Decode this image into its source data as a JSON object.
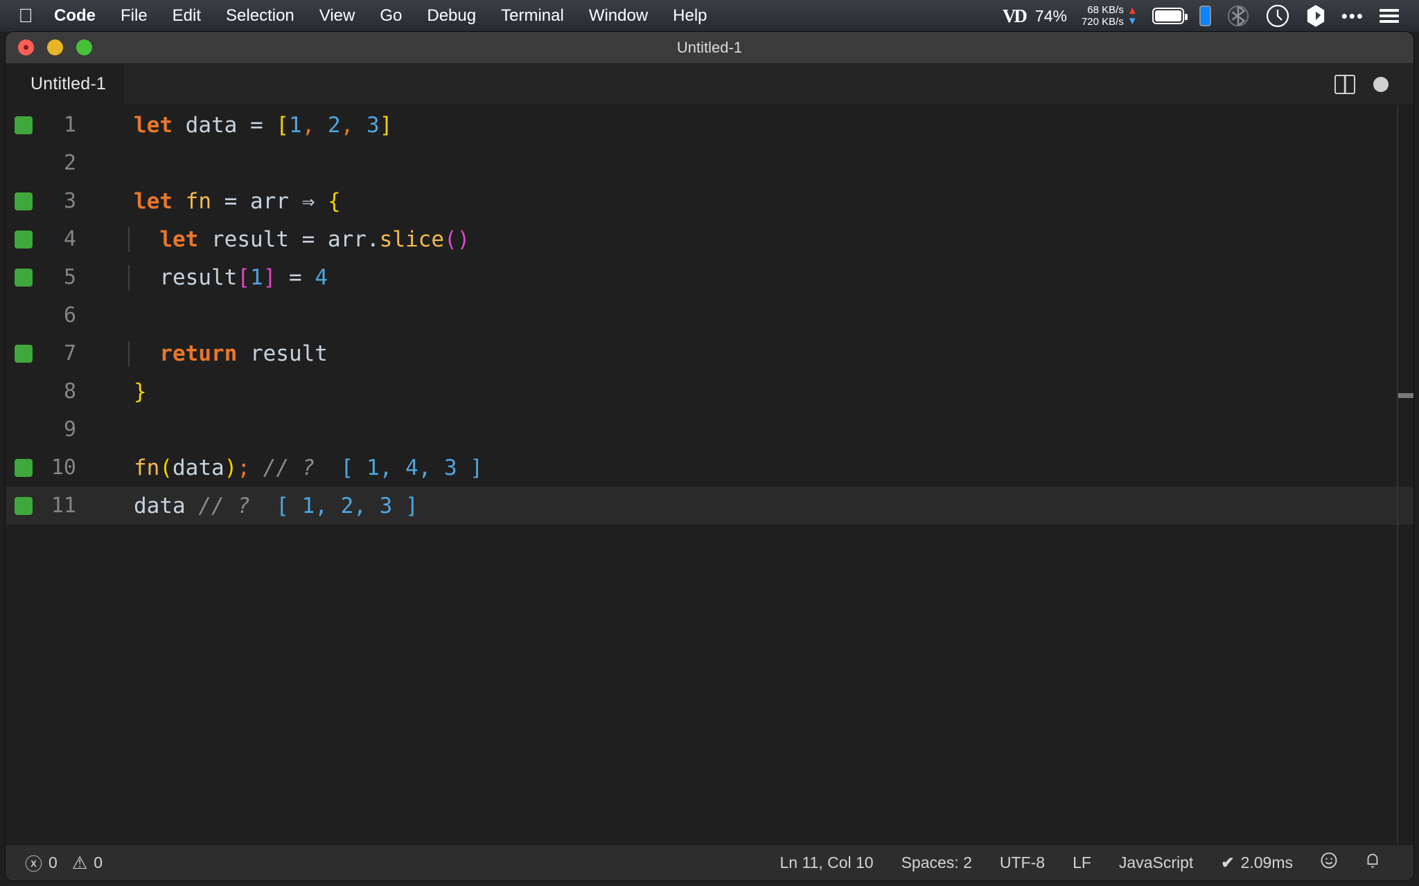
{
  "menubar": {
    "apple_icon": "apple-logo-icon",
    "items": [
      {
        "label": "Code",
        "bold": true
      },
      {
        "label": "File",
        "bold": false
      },
      {
        "label": "Edit",
        "bold": false
      },
      {
        "label": "Selection",
        "bold": false
      },
      {
        "label": "View",
        "bold": false
      },
      {
        "label": "Go",
        "bold": false
      },
      {
        "label": "Debug",
        "bold": false
      },
      {
        "label": "Terminal",
        "bold": false
      },
      {
        "label": "Window",
        "bold": false
      },
      {
        "label": "Help",
        "bold": false
      }
    ],
    "status": {
      "vd_mark": "VD",
      "battery_percent": "74%",
      "net_up": "68 KB/s",
      "net_down": "720 KB/s",
      "arrow_up": "▲",
      "arrow_down": "▼",
      "clock_icon": "clock-icon",
      "bluetooth_icon": "bluetooth-icon",
      "dots_icon": "•••",
      "list_icon": "control-center-icon"
    }
  },
  "window": {
    "title": "Untitled-1",
    "traffic_lights": [
      "close",
      "minimize",
      "maximize"
    ]
  },
  "tabbar": {
    "tab_label": "Untitled-1",
    "split_editor_icon": "split-editor-icon",
    "dirty_indicator": "unsaved-dot-icon"
  },
  "editor": {
    "language": "JavaScript",
    "colors": {
      "background": "#1f1f1f",
      "current_line": "#2a2a2a",
      "keyword": "#e8772b",
      "variable": "#c8d3de",
      "function": "#f5bb4d",
      "number": "#4fa6e0",
      "bracket_yellow": "#f5d300",
      "bracket_magenta": "#e246c8",
      "comment": "#8a8a8a",
      "linenumber": "#858585",
      "git_marker": "#3fa73b"
    },
    "lines": [
      {
        "number": "1",
        "marker": true,
        "indent_guide": false,
        "current": false,
        "tokens": [
          {
            "t": "let",
            "c": "kw"
          },
          {
            "t": " ",
            "c": "op"
          },
          {
            "t": "data",
            "c": "var"
          },
          {
            "t": " ",
            "c": "op"
          },
          {
            "t": "=",
            "c": "op"
          },
          {
            "t": " ",
            "c": "op"
          },
          {
            "t": "[",
            "c": "brk-y"
          },
          {
            "t": "1",
            "c": "num"
          },
          {
            "t": ",",
            "c": "punc"
          },
          {
            "t": " ",
            "c": "op"
          },
          {
            "t": "2",
            "c": "num"
          },
          {
            "t": ",",
            "c": "punc"
          },
          {
            "t": " ",
            "c": "op"
          },
          {
            "t": "3",
            "c": "num"
          },
          {
            "t": "]",
            "c": "brk-y"
          }
        ]
      },
      {
        "number": "2",
        "marker": false,
        "indent_guide": false,
        "current": false,
        "tokens": []
      },
      {
        "number": "3",
        "marker": true,
        "indent_guide": false,
        "current": false,
        "tokens": [
          {
            "t": "let",
            "c": "kw"
          },
          {
            "t": " ",
            "c": "op"
          },
          {
            "t": "fn",
            "c": "fnname"
          },
          {
            "t": " ",
            "c": "op"
          },
          {
            "t": "=",
            "c": "op"
          },
          {
            "t": " ",
            "c": "op"
          },
          {
            "t": "arr",
            "c": "var"
          },
          {
            "t": " ",
            "c": "op"
          },
          {
            "t": "⇒",
            "c": "arrow"
          },
          {
            "t": " ",
            "c": "op"
          },
          {
            "t": "{",
            "c": "brk-y"
          }
        ]
      },
      {
        "number": "4",
        "marker": true,
        "indent_guide": true,
        "current": false,
        "tokens": [
          {
            "t": "  ",
            "c": "op"
          },
          {
            "t": "let",
            "c": "kw"
          },
          {
            "t": " ",
            "c": "op"
          },
          {
            "t": "result",
            "c": "var"
          },
          {
            "t": " ",
            "c": "op"
          },
          {
            "t": "=",
            "c": "op"
          },
          {
            "t": " ",
            "c": "op"
          },
          {
            "t": "arr",
            "c": "var"
          },
          {
            "t": ".",
            "c": "var"
          },
          {
            "t": "slice",
            "c": "fnname"
          },
          {
            "t": "()",
            "c": "brk-m"
          }
        ]
      },
      {
        "number": "5",
        "marker": true,
        "indent_guide": true,
        "current": false,
        "tokens": [
          {
            "t": "  ",
            "c": "op"
          },
          {
            "t": "result",
            "c": "var"
          },
          {
            "t": "[",
            "c": "brk-m"
          },
          {
            "t": "1",
            "c": "num"
          },
          {
            "t": "]",
            "c": "brk-m"
          },
          {
            "t": " ",
            "c": "op"
          },
          {
            "t": "=",
            "c": "op"
          },
          {
            "t": " ",
            "c": "op"
          },
          {
            "t": "4",
            "c": "num"
          }
        ]
      },
      {
        "number": "6",
        "marker": false,
        "indent_guide": true,
        "current": false,
        "tokens": []
      },
      {
        "number": "7",
        "marker": true,
        "indent_guide": true,
        "current": false,
        "tokens": [
          {
            "t": "  ",
            "c": "op"
          },
          {
            "t": "return",
            "c": "kw"
          },
          {
            "t": " ",
            "c": "op"
          },
          {
            "t": "result",
            "c": "var"
          }
        ]
      },
      {
        "number": "8",
        "marker": false,
        "indent_guide": false,
        "current": false,
        "tokens": [
          {
            "t": "}",
            "c": "brk-y"
          }
        ]
      },
      {
        "number": "9",
        "marker": false,
        "indent_guide": false,
        "current": false,
        "tokens": []
      },
      {
        "number": "10",
        "marker": true,
        "indent_guide": false,
        "current": false,
        "tokens": [
          {
            "t": "fn",
            "c": "fnname"
          },
          {
            "t": "(",
            "c": "brk-y"
          },
          {
            "t": "data",
            "c": "var"
          },
          {
            "t": ")",
            "c": "brk-y"
          },
          {
            "t": ";",
            "c": "punc"
          },
          {
            "t": " ",
            "c": "op"
          },
          {
            "t": "// ?",
            "c": "cmt"
          },
          {
            "t": "  ",
            "c": "op"
          },
          {
            "t": "[ 1, 4, 3 ]",
            "c": "res"
          }
        ]
      },
      {
        "number": "11",
        "marker": true,
        "indent_guide": false,
        "current": true,
        "tokens": [
          {
            "t": "data",
            "c": "var"
          },
          {
            "t": " ",
            "c": "op"
          },
          {
            "t": "// ?",
            "c": "cmt"
          },
          {
            "t": "  ",
            "c": "op"
          },
          {
            "t": "[ 1, 2, 3 ]",
            "c": "res"
          }
        ]
      }
    ]
  },
  "statusbar": {
    "error_icon": "ⓧ",
    "error_count": "0",
    "warning_icon": "⚠",
    "warning_count": "0",
    "cursor_position": "Ln 11, Col 10",
    "indentation": "Spaces: 2",
    "encoding": "UTF-8",
    "eol": "LF",
    "language": "JavaScript",
    "quokka_check": "✔",
    "quokka_time": "2.09ms",
    "feedback_icon": "☺",
    "notification_icon": "🔔"
  }
}
